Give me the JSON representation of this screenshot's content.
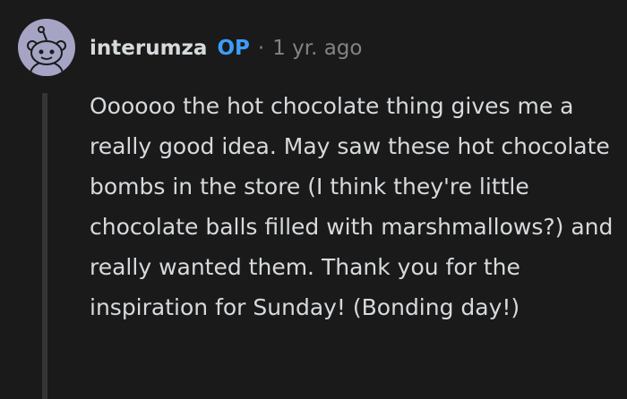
{
  "comment": {
    "username": "interumza",
    "op_badge": "OP",
    "separator": "·",
    "timestamp": "1 yr. ago",
    "text": "Oooooo the hot chocolate thing gives me a really good idea. May saw these hot chocolate bombs in the store (I think they're little chocolate balls filled with marshmallows?) and really wanted them. Thank you for the inspiration for Sunday! (Bonding day!)",
    "avatar_icon": "snoo-avatar-icon"
  },
  "colors": {
    "background": "#1a1a1b",
    "text": "#d7dadc",
    "muted": "#818384",
    "op_accent": "#3d9df7",
    "thread_line": "#343536",
    "avatar_bg": "#a5a4c4"
  }
}
